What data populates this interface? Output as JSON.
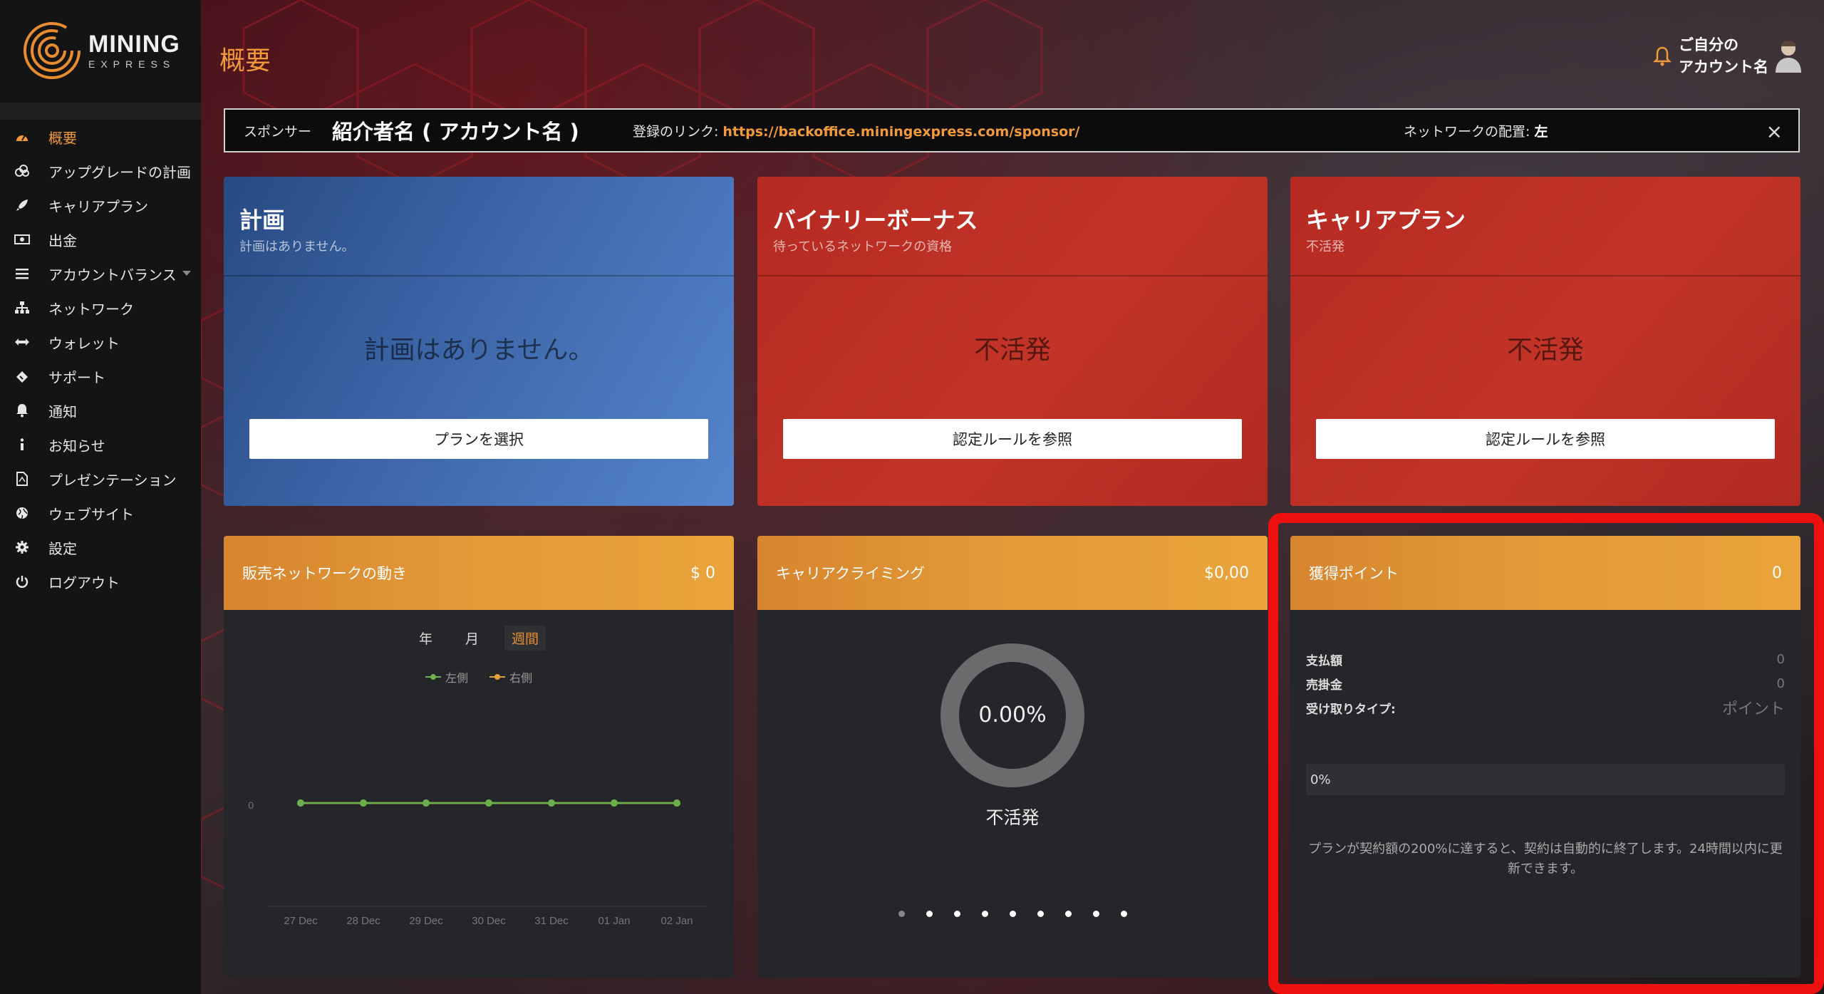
{
  "brand": {
    "name_line1": "MINING",
    "name_line2": "EXPRESS"
  },
  "colors": {
    "accent": "#f29a3a",
    "highlight": "#ee0f0f",
    "blue_card": "#3d66a8",
    "red_card": "#c23427",
    "orange_header": "#e39b38"
  },
  "sidebar": {
    "items": [
      {
        "label": "概要",
        "icon": "dashboard-icon",
        "active": true
      },
      {
        "label": "アップグレードの計画",
        "icon": "coins-icon"
      },
      {
        "label": "キャリアプラン",
        "icon": "rocket-icon"
      },
      {
        "label": "出金",
        "icon": "money-icon"
      },
      {
        "label": "アカウントバランス",
        "icon": "list-icon",
        "has_submenu": true
      },
      {
        "label": "ネットワーク",
        "icon": "sitemap-icon"
      },
      {
        "label": "ウォレット",
        "icon": "transfer-icon"
      },
      {
        "label": "サポート",
        "icon": "ticket-icon"
      },
      {
        "label": "通知",
        "icon": "bell-icon"
      },
      {
        "label": "お知らせ",
        "icon": "info-icon"
      },
      {
        "label": "プレゼンテーション",
        "icon": "pdf-icon"
      },
      {
        "label": "ウェブサイト",
        "icon": "globe-icon"
      },
      {
        "label": "設定",
        "icon": "gear-icon"
      },
      {
        "label": "ログアウト",
        "icon": "power-icon"
      }
    ]
  },
  "header": {
    "title": "概要",
    "user_line1": "ご自分の",
    "user_line2": "アカウント名"
  },
  "sponsor": {
    "label": "スポンサー",
    "referrer": "紹介者名 ( アカウント名 )",
    "link_label": "登録のリンク:",
    "link": "https://backoffice.miningexpress.com/sponsor/",
    "placement_label": "ネットワークの配置:",
    "placement_value": "左",
    "close": "×"
  },
  "cards": {
    "plan": {
      "title": "計画",
      "subtitle": "計画はありません。",
      "status": "計画はありません。",
      "button": "プランを選択"
    },
    "binary": {
      "title": "バイナリーボーナス",
      "subtitle": "待っているネットワークの資格",
      "status": "不活発",
      "button": "認定ルールを参照"
    },
    "career": {
      "title": "キャリアプラン",
      "subtitle": "不活発",
      "status": "不活発",
      "button": "認定ルールを参照"
    }
  },
  "sales_network": {
    "title": "販売ネットワークの動き",
    "value": "$ 0",
    "tabs": [
      "年",
      "月",
      "週間"
    ],
    "active_tab": "週間",
    "chart_data": {
      "type": "line",
      "x": [
        "27 Dec",
        "28 Dec",
        "29 Dec",
        "30 Dec",
        "31 Dec",
        "01 Jan",
        "02 Jan"
      ],
      "series": [
        {
          "name": "左側",
          "color": "#6ab04c",
          "values": [
            0,
            0,
            0,
            0,
            0,
            0,
            0
          ]
        },
        {
          "name": "右側",
          "color": "#e3a03a",
          "values": [
            0,
            0,
            0,
            0,
            0,
            0,
            0
          ]
        }
      ],
      "yticks": [
        "0"
      ],
      "legend": "top-center"
    }
  },
  "career_climbing": {
    "title": "キャリアクライミング",
    "value": "$0,00",
    "percent_label": "0.00%",
    "percent": 0,
    "status": "不活発",
    "carousel_dots": 9
  },
  "points": {
    "title": "獲得ポイント",
    "value": "0",
    "rows": [
      {
        "label": "支払額",
        "value": "0"
      },
      {
        "label": "売掛金",
        "value": "0"
      },
      {
        "label": "受け取りタイプ:",
        "value": "ポイント"
      }
    ],
    "progress_label": "0%",
    "progress": 0,
    "note": "プランが契約額の200%に達すると、契約は自動的に終了します。24時間以内に更新できます。"
  }
}
